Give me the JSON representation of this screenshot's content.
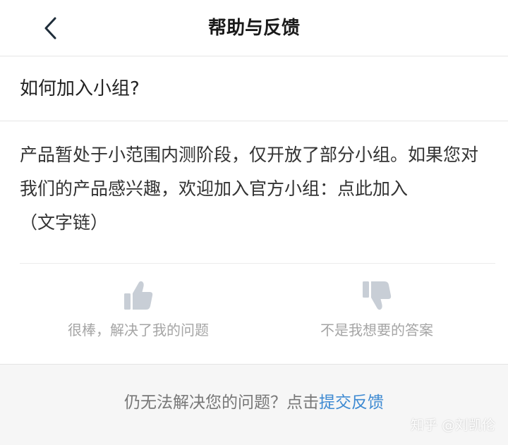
{
  "navbar": {
    "title": "帮助与反馈",
    "back_icon": "chevron-left-icon"
  },
  "question": {
    "title": "如何加入小组?"
  },
  "answer": {
    "text": "产品暂处于小范围内测阶段，仅开放了部分小组。如果您对我们的产品感兴趣，欢迎加入官方小组：",
    "link_text": "点此加入",
    "suffix": "（文字链）"
  },
  "feedback": {
    "helpful_label": "很棒，解决了我的问题",
    "helpful_icon": "thumbs-up-icon",
    "unhelpful_label": "不是我想要的答案",
    "unhelpful_icon": "thumbs-down-icon"
  },
  "footer": {
    "prompt": "仍无法解决您的问题？点击",
    "link": "提交反馈"
  },
  "watermark": "知乎 @刘凯伦",
  "colors": {
    "accent": "#3e8ad2",
    "icon_gray": "#c8ced6",
    "muted_text": "#a5a5a5"
  }
}
